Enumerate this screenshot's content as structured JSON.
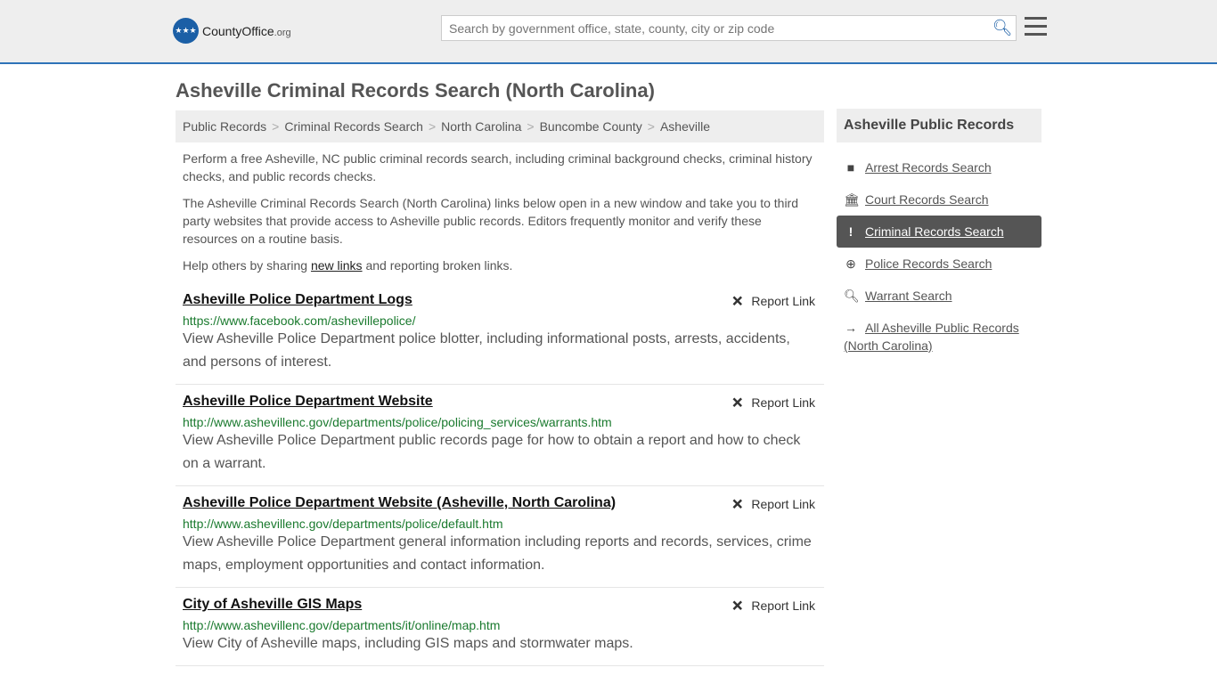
{
  "header": {
    "logo_text": "CountyOffice",
    "logo_suffix": ".org",
    "search_placeholder": "Search by government office, state, county, city or zip code"
  },
  "page_title": "Asheville Criminal Records Search (North Carolina)",
  "breadcrumb": [
    "Public Records",
    "Criminal Records Search",
    "North Carolina",
    "Buncombe County",
    "Asheville"
  ],
  "intro": {
    "p1": "Perform a free Asheville, NC public criminal records search, including criminal background checks, criminal history checks, and public records checks.",
    "p2": "The Asheville Criminal Records Search (North Carolina) links below open in a new window and take you to third party websites that provide access to Asheville public records. Editors frequently monitor and verify these resources on a routine basis.",
    "p3_pre": "Help others by sharing ",
    "p3_link": "new links",
    "p3_post": " and reporting broken links."
  },
  "report_label": "Report Link",
  "listings": [
    {
      "title": "Asheville Police Department Logs",
      "url": "https://www.facebook.com/ashevillepolice/",
      "desc": "View Asheville Police Department police blotter, including informational posts, arrests, accidents, and persons of interest."
    },
    {
      "title": "Asheville Police Department Website",
      "url": "http://www.ashevillenc.gov/departments/police/policing_services/warrants.htm",
      "desc": "View Asheville Police Department public records page for how to obtain a report and how to check on a warrant."
    },
    {
      "title": "Asheville Police Department Website (Asheville, North Carolina)",
      "url": "http://www.ashevillenc.gov/departments/police/default.htm",
      "desc": "View Asheville Police Department general information including reports and records, services, crime maps, employment opportunities and contact information."
    },
    {
      "title": "City of Asheville GIS Maps",
      "url": "http://www.ashevillenc.gov/departments/it/online/map.htm",
      "desc": "View City of Asheville maps, including GIS maps and stormwater maps."
    }
  ],
  "sidebar": {
    "title": "Asheville Public Records",
    "items": [
      {
        "label": "Arrest Records Search",
        "icon": "square-icon"
      },
      {
        "label": "Court Records Search",
        "icon": "courthouse-icon"
      },
      {
        "label": "Criminal Records Search",
        "icon": "exclamation-icon",
        "active": true
      },
      {
        "label": "Police Records Search",
        "icon": "crosshairs-icon"
      },
      {
        "label": "Warrant Search",
        "icon": "search-plus-icon"
      },
      {
        "label": "All Asheville Public Records (North Carolina)",
        "icon": "arrow-right-icon"
      }
    ]
  }
}
